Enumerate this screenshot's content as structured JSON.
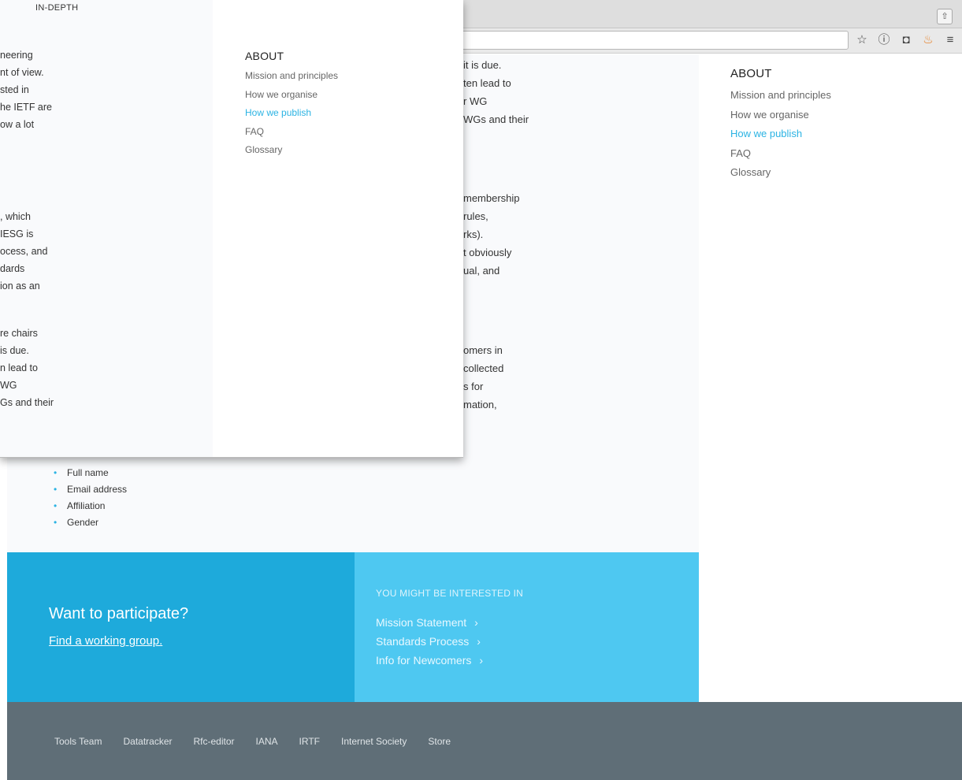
{
  "chrome": {
    "tabstrip_button": "⇧",
    "icons": [
      "star-icon",
      "info-icon",
      "ghost-icon",
      "fire-icon",
      "menu-icon"
    ]
  },
  "background_text": {
    "column_a": [
      "it is due.",
      "ten lead to",
      "r WG",
      "WGs and their"
    ],
    "column_b": [
      "membership",
      "rules,",
      "rks).",
      "t obviously",
      "ual, and"
    ],
    "column_c": [
      "omers in",
      "collected",
      "s for",
      "mation,"
    ]
  },
  "side_nav": {
    "title": "ABOUT",
    "items": [
      "Mission and principles",
      "How we organise",
      "How we publish",
      "FAQ",
      "Glossary"
    ],
    "active_index": 2
  },
  "bullets": [
    "Full name",
    "Email address",
    "Affiliation",
    "Gender"
  ],
  "cta": {
    "heading": "Want to participate?",
    "link": "Find a working group."
  },
  "interest": {
    "title": "YOU MIGHT BE INTERESTED IN",
    "links": [
      "Mission Statement",
      "Standards Process",
      "Info for Newcomers"
    ],
    "chevron": "›"
  },
  "footer": {
    "links": [
      "Tools Team",
      "Datatracker",
      "Rfc-editor",
      "IANA",
      "IRTF",
      "Internet Society",
      "Store"
    ]
  },
  "overlay": {
    "header": "IN-DEPTH",
    "para1": [
      "neering",
      "nt of view.",
      "sted in",
      "he IETF are",
      "ow a lot"
    ],
    "para2": [
      ", which",
      "IESG is",
      "ocess, and",
      "dards",
      "ion as an"
    ],
    "para3": [
      "re chairs",
      "is due.",
      "n lead to",
      "WG",
      "Gs and their"
    ],
    "nav": {
      "title": "ABOUT",
      "items": [
        "Mission and principles",
        "How we organise",
        "How we publish",
        "FAQ",
        "Glossary"
      ],
      "active_index": 2
    }
  },
  "colors": {
    "accent": "#2bb3e3",
    "cta_left": "#1eaadb",
    "cta_right": "#4ec8f1",
    "footer": "#5f6e77"
  }
}
